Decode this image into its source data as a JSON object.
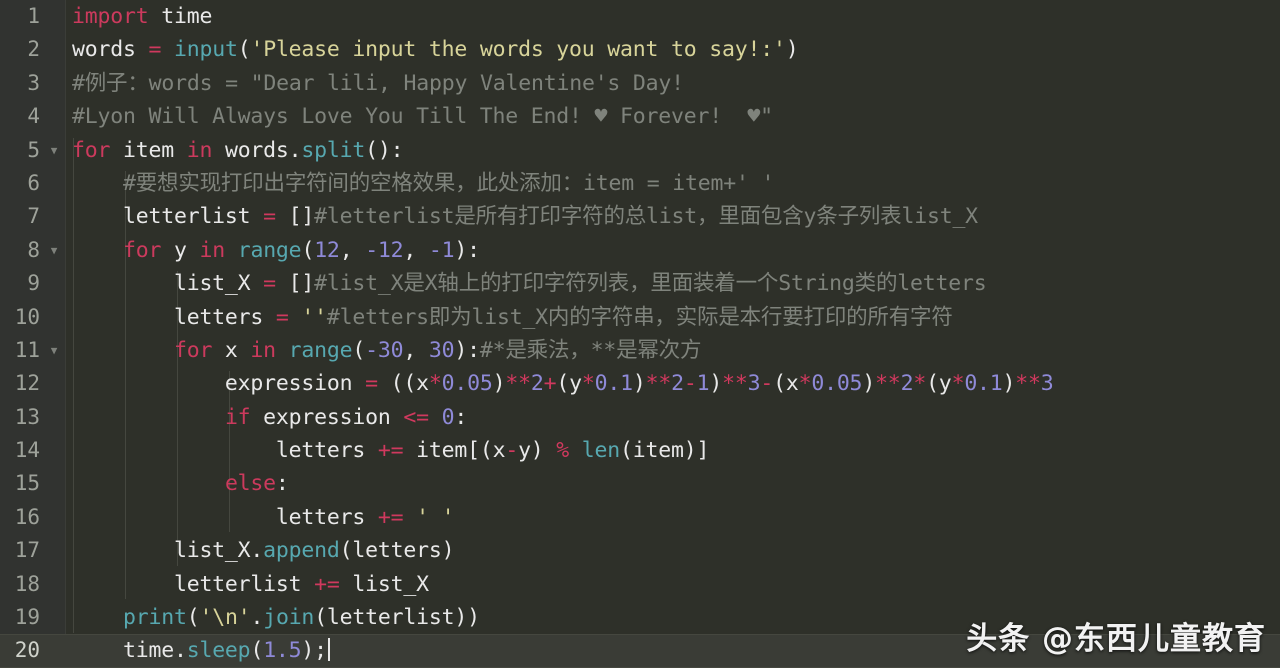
{
  "editor": {
    "theme_name": "dark-python-editor",
    "colors": {
      "background": "#2e3029",
      "gutter_background": "#313330",
      "current_line_background": "#3a3c36",
      "keyword": "#cc3a5d",
      "function": "#57a8b0",
      "string": "#d8d49a",
      "number": "#8f8ad8",
      "operator": "#d0395e",
      "comment": "#7f837c",
      "plain_text": "#e6e6e6",
      "line_number": "#9ea29a"
    },
    "language": "Python",
    "current_line": 20,
    "caret_line": 20,
    "fold_markers": [
      5,
      8,
      11
    ],
    "line_numbers": [
      1,
      2,
      3,
      4,
      5,
      6,
      7,
      8,
      9,
      10,
      11,
      12,
      13,
      14,
      15,
      16,
      17,
      18,
      19,
      20
    ],
    "fold_icon": "▼"
  },
  "code": {
    "lines": [
      {
        "n": 1,
        "text": "import time",
        "tokens": [
          {
            "t": "import",
            "c": "kw"
          },
          {
            "t": " time",
            "c": "pl"
          }
        ]
      },
      {
        "n": 2,
        "text": "words = input('Please input the words you want to say!:')",
        "tokens": [
          {
            "t": "words ",
            "c": "pl"
          },
          {
            "t": "=",
            "c": "op"
          },
          {
            "t": " ",
            "c": "pl"
          },
          {
            "t": "input",
            "c": "fn"
          },
          {
            "t": "(",
            "c": "punc"
          },
          {
            "t": "'Please input the words you want to say!:'",
            "c": "str"
          },
          {
            "t": ")",
            "c": "punc"
          }
        ]
      },
      {
        "n": 3,
        "text": "#例子：words = \"Dear lili, Happy Valentine's Day!",
        "tokens": [
          {
            "t": "#例子：words = \"Dear lili, Happy Valentine's Day!",
            "c": "cmt"
          }
        ]
      },
      {
        "n": 4,
        "text": "#Lyon Will Always Love You Till The End! ♥ Forever!  ♥\"",
        "tokens": [
          {
            "t": "#Lyon Will Always Love You Till The End! ♥ Forever!  ♥\"",
            "c": "cmt"
          }
        ]
      },
      {
        "n": 5,
        "text": "for item in words.split():",
        "tokens": [
          {
            "t": "for",
            "c": "kw"
          },
          {
            "t": " item ",
            "c": "pl"
          },
          {
            "t": "in",
            "c": "kw"
          },
          {
            "t": " words.",
            "c": "pl"
          },
          {
            "t": "split",
            "c": "fn"
          },
          {
            "t": "():",
            "c": "punc"
          }
        ]
      },
      {
        "n": 6,
        "text": "    #要想实现打印出字符间的空格效果，此处添加：item = item+' '",
        "tokens": [
          {
            "t": "    ",
            "c": "pl"
          },
          {
            "t": "#要想实现打印出字符间的空格效果，此处添加：item = item+' '",
            "c": "cmt"
          }
        ]
      },
      {
        "n": 7,
        "text": "    letterlist = []#letterlist是所有打印字符的总list，里面包含y条子列表list_X",
        "tokens": [
          {
            "t": "    letterlist ",
            "c": "pl"
          },
          {
            "t": "=",
            "c": "op"
          },
          {
            "t": " []",
            "c": "punc"
          },
          {
            "t": "#letterlist是所有打印字符的总list，里面包含y条子列表list_X",
            "c": "cmt"
          }
        ]
      },
      {
        "n": 8,
        "text": "    for y in range(12, -12, -1):",
        "tokens": [
          {
            "t": "    ",
            "c": "pl"
          },
          {
            "t": "for",
            "c": "kw"
          },
          {
            "t": " y ",
            "c": "pl"
          },
          {
            "t": "in",
            "c": "kw"
          },
          {
            "t": " ",
            "c": "pl"
          },
          {
            "t": "range",
            "c": "fn"
          },
          {
            "t": "(",
            "c": "punc"
          },
          {
            "t": "12",
            "c": "num"
          },
          {
            "t": ", ",
            "c": "punc"
          },
          {
            "t": "-12",
            "c": "num"
          },
          {
            "t": ", ",
            "c": "punc"
          },
          {
            "t": "-1",
            "c": "num"
          },
          {
            "t": "):",
            "c": "punc"
          }
        ]
      },
      {
        "n": 9,
        "text": "        list_X = []#list_X是X轴上的打印字符列表，里面装着一个String类的letters",
        "tokens": [
          {
            "t": "        list_X ",
            "c": "pl"
          },
          {
            "t": "=",
            "c": "op"
          },
          {
            "t": " []",
            "c": "punc"
          },
          {
            "t": "#list_X是X轴上的打印字符列表，里面装着一个String类的letters",
            "c": "cmt"
          }
        ]
      },
      {
        "n": 10,
        "text": "        letters = ''#letters即为list_X内的字符串，实际是本行要打印的所有字符",
        "tokens": [
          {
            "t": "        letters ",
            "c": "pl"
          },
          {
            "t": "=",
            "c": "op"
          },
          {
            "t": " ",
            "c": "pl"
          },
          {
            "t": "''",
            "c": "str"
          },
          {
            "t": "#letters即为list_X内的字符串，实际是本行要打印的所有字符",
            "c": "cmt"
          }
        ]
      },
      {
        "n": 11,
        "text": "        for x in range(-30, 30):#*是乘法，**是幂次方",
        "tokens": [
          {
            "t": "        ",
            "c": "pl"
          },
          {
            "t": "for",
            "c": "kw"
          },
          {
            "t": " x ",
            "c": "pl"
          },
          {
            "t": "in",
            "c": "kw"
          },
          {
            "t": " ",
            "c": "pl"
          },
          {
            "t": "range",
            "c": "fn"
          },
          {
            "t": "(",
            "c": "punc"
          },
          {
            "t": "-30",
            "c": "num"
          },
          {
            "t": ", ",
            "c": "punc"
          },
          {
            "t": "30",
            "c": "num"
          },
          {
            "t": "):",
            "c": "punc"
          },
          {
            "t": "#*是乘法，**是幂次方",
            "c": "cmt"
          }
        ]
      },
      {
        "n": 12,
        "text": "            expression = ((x*0.05)**2+(y*0.1)**2-1)**3-(x*0.05)**2*(y*0.1)**3",
        "tokens": [
          {
            "t": "            expression ",
            "c": "pl"
          },
          {
            "t": "=",
            "c": "op"
          },
          {
            "t": " ((x",
            "c": "punc"
          },
          {
            "t": "*",
            "c": "op"
          },
          {
            "t": "0.05",
            "c": "num"
          },
          {
            "t": ")",
            "c": "punc"
          },
          {
            "t": "**",
            "c": "op"
          },
          {
            "t": "2",
            "c": "num"
          },
          {
            "t": "+",
            "c": "op"
          },
          {
            "t": "(y",
            "c": "punc"
          },
          {
            "t": "*",
            "c": "op"
          },
          {
            "t": "0.1",
            "c": "num"
          },
          {
            "t": ")",
            "c": "punc"
          },
          {
            "t": "**",
            "c": "op"
          },
          {
            "t": "2",
            "c": "num"
          },
          {
            "t": "-",
            "c": "op"
          },
          {
            "t": "1",
            "c": "num"
          },
          {
            "t": ")",
            "c": "punc"
          },
          {
            "t": "**",
            "c": "op"
          },
          {
            "t": "3",
            "c": "num"
          },
          {
            "t": "-",
            "c": "op"
          },
          {
            "t": "(x",
            "c": "punc"
          },
          {
            "t": "*",
            "c": "op"
          },
          {
            "t": "0.05",
            "c": "num"
          },
          {
            "t": ")",
            "c": "punc"
          },
          {
            "t": "**",
            "c": "op"
          },
          {
            "t": "2",
            "c": "num"
          },
          {
            "t": "*",
            "c": "op"
          },
          {
            "t": "(y",
            "c": "punc"
          },
          {
            "t": "*",
            "c": "op"
          },
          {
            "t": "0.1",
            "c": "num"
          },
          {
            "t": ")",
            "c": "punc"
          },
          {
            "t": "**",
            "c": "op"
          },
          {
            "t": "3",
            "c": "num"
          }
        ]
      },
      {
        "n": 13,
        "text": "            if expression <= 0:",
        "tokens": [
          {
            "t": "            ",
            "c": "pl"
          },
          {
            "t": "if",
            "c": "kw"
          },
          {
            "t": " expression ",
            "c": "pl"
          },
          {
            "t": "<=",
            "c": "op"
          },
          {
            "t": " ",
            "c": "pl"
          },
          {
            "t": "0",
            "c": "num"
          },
          {
            "t": ":",
            "c": "punc"
          }
        ]
      },
      {
        "n": 14,
        "text": "                letters += item[(x-y) % len(item)]",
        "tokens": [
          {
            "t": "                letters ",
            "c": "pl"
          },
          {
            "t": "+=",
            "c": "op"
          },
          {
            "t": " item[(x",
            "c": "punc"
          },
          {
            "t": "-",
            "c": "op"
          },
          {
            "t": "y) ",
            "c": "punc"
          },
          {
            "t": "%",
            "c": "op"
          },
          {
            "t": " ",
            "c": "pl"
          },
          {
            "t": "len",
            "c": "fn"
          },
          {
            "t": "(item)]",
            "c": "punc"
          }
        ]
      },
      {
        "n": 15,
        "text": "            else:",
        "tokens": [
          {
            "t": "            ",
            "c": "pl"
          },
          {
            "t": "else",
            "c": "kw"
          },
          {
            "t": ":",
            "c": "punc"
          }
        ]
      },
      {
        "n": 16,
        "text": "                letters += ' '",
        "tokens": [
          {
            "t": "                letters ",
            "c": "pl"
          },
          {
            "t": "+=",
            "c": "op"
          },
          {
            "t": " ",
            "c": "pl"
          },
          {
            "t": "' '",
            "c": "str"
          }
        ]
      },
      {
        "n": 17,
        "text": "        list_X.append(letters)",
        "tokens": [
          {
            "t": "        list_X.",
            "c": "pl"
          },
          {
            "t": "append",
            "c": "fn"
          },
          {
            "t": "(letters)",
            "c": "punc"
          }
        ]
      },
      {
        "n": 18,
        "text": "        letterlist += list_X",
        "tokens": [
          {
            "t": "        letterlist ",
            "c": "pl"
          },
          {
            "t": "+=",
            "c": "op"
          },
          {
            "t": " list_X",
            "c": "pl"
          }
        ]
      },
      {
        "n": 19,
        "text": "    print('\\n'.join(letterlist))",
        "tokens": [
          {
            "t": "    ",
            "c": "pl"
          },
          {
            "t": "print",
            "c": "fn"
          },
          {
            "t": "(",
            "c": "punc"
          },
          {
            "t": "'\\n'",
            "c": "str"
          },
          {
            "t": ".",
            "c": "punc"
          },
          {
            "t": "join",
            "c": "fn"
          },
          {
            "t": "(letterlist))",
            "c": "punc"
          }
        ]
      },
      {
        "n": 20,
        "text": "    time.sleep(1.5);",
        "tokens": [
          {
            "t": "    time.",
            "c": "pl"
          },
          {
            "t": "sleep",
            "c": "fn"
          },
          {
            "t": "(",
            "c": "punc"
          },
          {
            "t": "1.5",
            "c": "num"
          },
          {
            "t": ");",
            "c": "punc"
          }
        ]
      }
    ]
  },
  "watermark": {
    "text": "头条 @东西儿童教育"
  }
}
